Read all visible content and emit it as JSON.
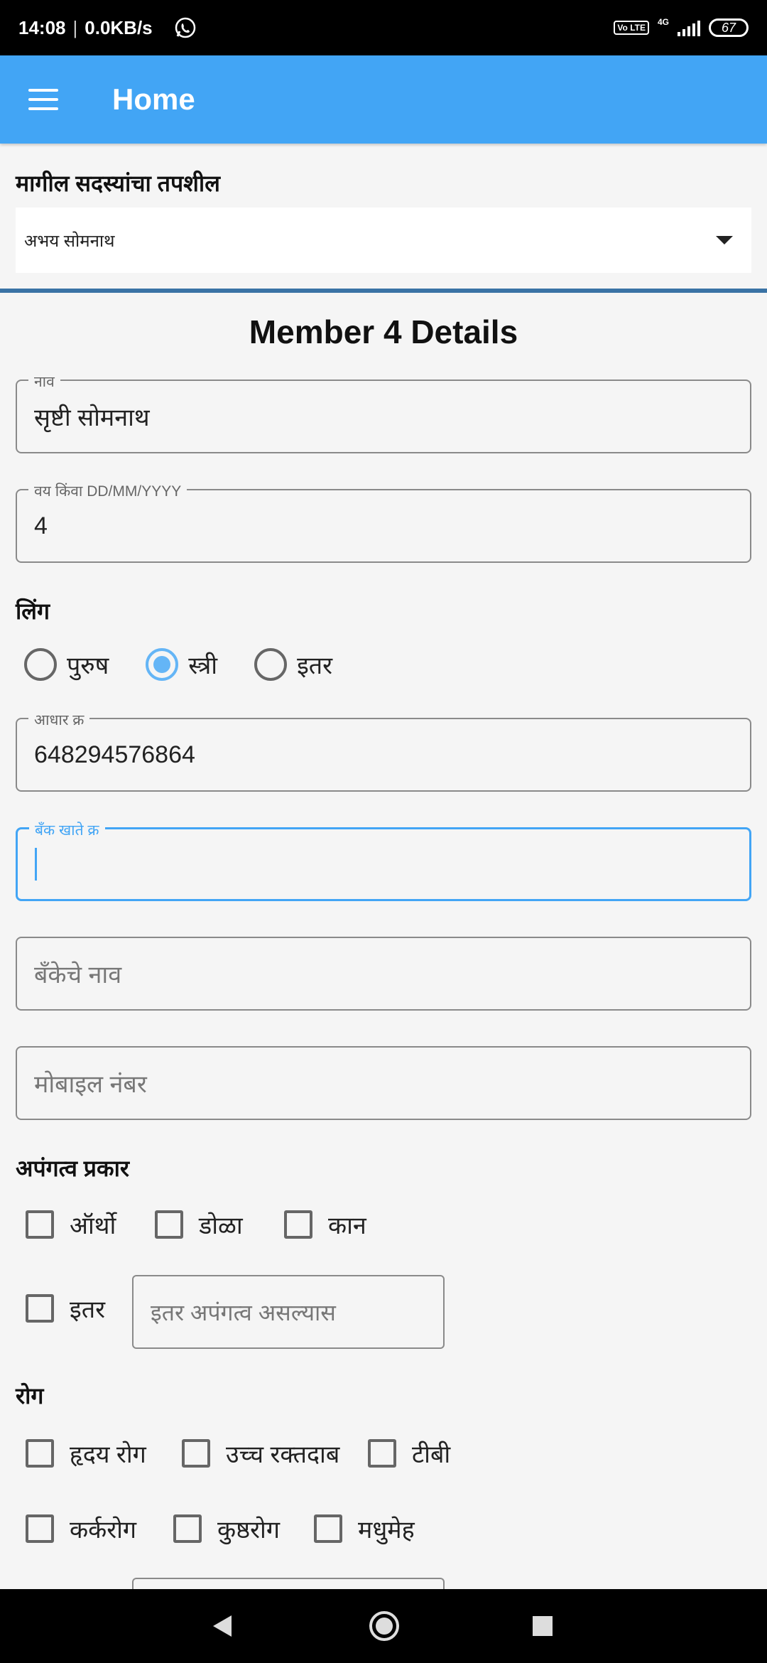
{
  "status_bar": {
    "time": "14:08",
    "speed": "0.0KB/s",
    "volte": "Vo LTE",
    "network": "4G",
    "battery": "67",
    "icons": [
      "whatsapp-icon",
      "signal-icon",
      "battery-icon"
    ]
  },
  "app_bar": {
    "title": "Home",
    "menu_icon": "menu-icon",
    "color": "#42a5f5"
  },
  "previous_members": {
    "label": "मागील सदस्यांचा तपशील",
    "selected": "अभय सोमनाथ"
  },
  "member": {
    "title": "Member 4 Details",
    "name": {
      "label": "नाव",
      "value": "सृष्टी सोमनाथ"
    },
    "age": {
      "label": "वय किंवा DD/MM/YYYY",
      "value": "4"
    },
    "gender": {
      "label": "लिंग",
      "options": [
        "पुरुष",
        "स्त्री",
        "इतर"
      ],
      "selected": "स्त्री"
    },
    "aadhaar": {
      "label": "आधार क्र",
      "value": "648294576864"
    },
    "bank_account": {
      "label": "बँक खाते क्र",
      "value": ""
    },
    "bank_name": {
      "placeholder": "बँकेचे नाव"
    },
    "mobile": {
      "placeholder": "मोबाइल नंबर"
    },
    "disability": {
      "label": "अपंगत्व प्रकार",
      "options": [
        "ऑर्थो",
        "डोळा",
        "कान",
        "इतर"
      ],
      "other_placeholder": "इतर अपंगत्व असल्यास"
    },
    "disease": {
      "label": "रोग",
      "options": [
        "हृदय रोग",
        "उच्च रक्तदाब",
        "टीबी",
        "कर्करोग",
        "कुष्ठरोग",
        "मधुमेह"
      ]
    }
  }
}
